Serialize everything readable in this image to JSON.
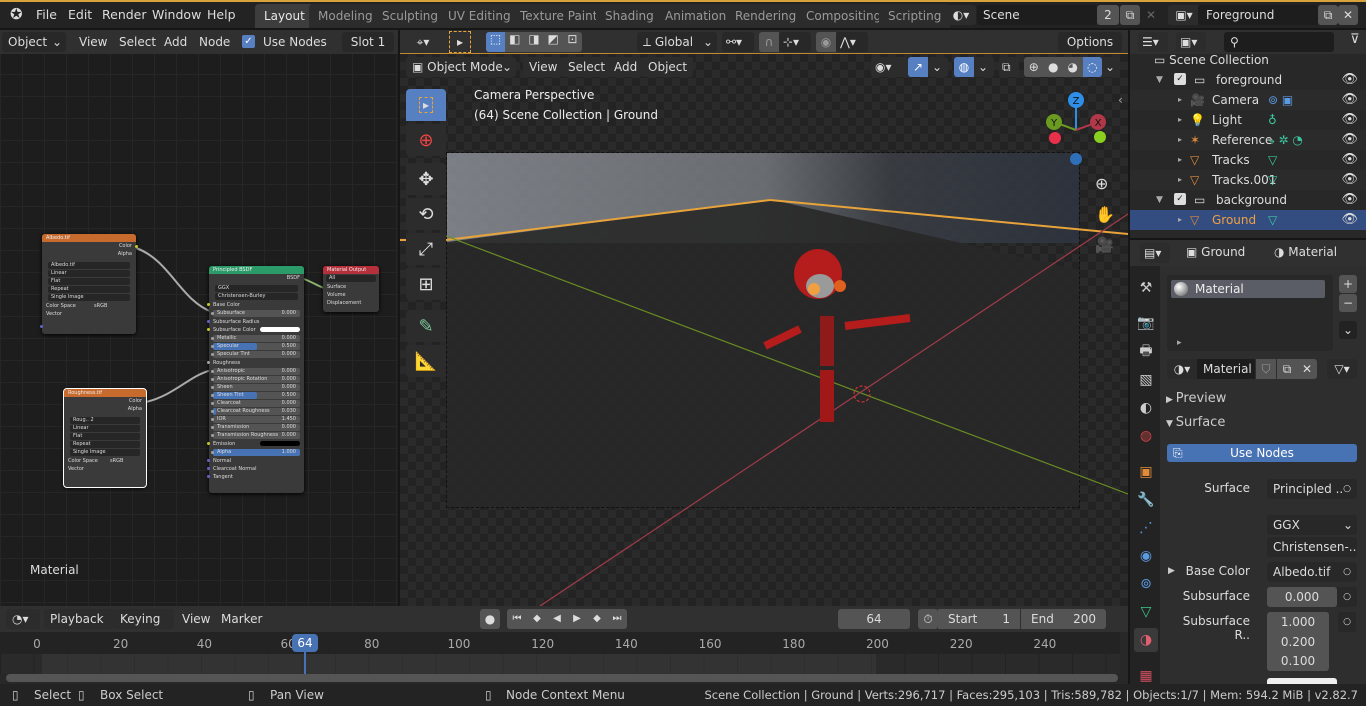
{
  "topbar": {
    "menus": [
      "File",
      "Edit",
      "Render",
      "Window",
      "Help"
    ],
    "workspaces": [
      "Layout",
      "Modeling",
      "Sculpting",
      "UV Editing",
      "Texture Paint",
      "Shading",
      "Animation",
      "Rendering",
      "Compositing",
      "Scripting"
    ],
    "active_workspace": "Layout",
    "scene": {
      "name": "Scene",
      "users": "2"
    },
    "view_layer": "Foreground"
  },
  "node_editor": {
    "header": {
      "mode": "Object",
      "menus": [
        "View",
        "Select",
        "Add",
        "Node"
      ],
      "use_nodes_label": "Use Nodes",
      "use_nodes_checked": true,
      "slot": "Slot 1"
    },
    "label": "Material",
    "albedo_node": {
      "title": "Albedo.tif",
      "outputs": [
        "Color",
        "Alpha"
      ],
      "image": "Albedo.tif",
      "interp": "Linear",
      "proj": "Flat",
      "ext": "Repeat",
      "source": "Single Image",
      "cs_label": "Color Space",
      "cs": "sRGB",
      "input": "Vector"
    },
    "rough_node": {
      "title": "Roughness.tif",
      "outputs": [
        "Color",
        "Alpha"
      ],
      "image": "Roug..",
      "users": "2",
      "interp": "Linear",
      "proj": "Flat",
      "ext": "Repeat",
      "source": "Single Image",
      "cs_label": "Color Space",
      "cs": "sRGB",
      "input": "Vector"
    },
    "bsdf_node": {
      "title": "Principled BSDF",
      "output": "BSDF",
      "dist": "GGX",
      "sss": "Christensen-Burley",
      "rows": [
        {
          "label": "Base Color",
          "type": "socket"
        },
        {
          "label": "Subsurface",
          "value": "0.000"
        },
        {
          "label": "Subsurface Radius",
          "type": "select"
        },
        {
          "label": "Subsurface Color",
          "type": "color"
        },
        {
          "label": "Metallic",
          "value": "0.000"
        },
        {
          "label": "Specular",
          "value": "0.500",
          "fill": 0.5
        },
        {
          "label": "Specular Tint",
          "value": "0.000"
        },
        {
          "label": "Roughness",
          "type": "socket"
        },
        {
          "label": "Anisotropic",
          "value": "0.000"
        },
        {
          "label": "Anisotropic Rotation",
          "value": "0.000"
        },
        {
          "label": "Sheen",
          "value": "0.000"
        },
        {
          "label": "Sheen Tint",
          "value": "0.500",
          "fill": 0.5
        },
        {
          "label": "Clearcoat",
          "value": "0.000"
        },
        {
          "label": "Clearcoat Roughness",
          "value": "0.030",
          "fill": 0.03
        },
        {
          "label": "IOR",
          "value": "1.450"
        },
        {
          "label": "Transmission",
          "value": "0.000"
        },
        {
          "label": "Transmission Roughness",
          "value": "0.000"
        },
        {
          "label": "Emission",
          "type": "black"
        },
        {
          "label": "Alpha",
          "value": "1.000",
          "fill": 1.0
        },
        {
          "label": "Normal",
          "type": "socket"
        },
        {
          "label": "Clearcoat Normal",
          "type": "socket"
        },
        {
          "label": "Tangent",
          "type": "socket"
        }
      ]
    },
    "output_node": {
      "title": "Material Output",
      "target": "All",
      "inputs": [
        "Surface",
        "Volume",
        "Displacement"
      ]
    }
  },
  "viewport": {
    "toolbar": {
      "orientation": "Global",
      "options": "Options"
    },
    "header": {
      "mode": "Object Mode",
      "menus": [
        "View",
        "Select",
        "Add",
        "Object"
      ]
    },
    "overlay_title": "Camera Perspective",
    "overlay_sub": "(64) Scene Collection | Ground",
    "gizmo_axes": [
      "Z",
      "Y",
      "X"
    ]
  },
  "outliner": {
    "root": "Scene Collection",
    "items": [
      {
        "name": "foreground",
        "kind": "collection",
        "depth": 1
      },
      {
        "name": "Camera",
        "kind": "camera",
        "depth": 2
      },
      {
        "name": "Light",
        "kind": "light",
        "depth": 2
      },
      {
        "name": "Reference",
        "kind": "armature",
        "depth": 2
      },
      {
        "name": "Tracks",
        "kind": "mesh",
        "depth": 2
      },
      {
        "name": "Tracks.001",
        "kind": "mesh",
        "depth": 2
      },
      {
        "name": "background",
        "kind": "collection",
        "depth": 1
      },
      {
        "name": "Ground",
        "kind": "mesh",
        "depth": 2,
        "selected": true
      }
    ]
  },
  "properties": {
    "breadcrumb": [
      "Ground",
      "Material"
    ],
    "slots": [
      "Material"
    ],
    "material_name": "Material",
    "panels": {
      "preview": "Preview",
      "surface": "Surface"
    },
    "use_nodes": "Use Nodes",
    "surface": {
      "label": "Surface",
      "value": "Principled .."
    },
    "distribution": "GGX",
    "subsurface_method": "Christensen-..",
    "base_color": {
      "label": "Base Color",
      "value": "Albedo.tif"
    },
    "subsurface": {
      "label": "Subsurface",
      "value": "0.000"
    },
    "subsurface_radius": {
      "label": "Subsurface R..",
      "values": [
        "1.000",
        "0.200",
        "0.100"
      ]
    }
  },
  "timeline": {
    "menus": [
      "Playback",
      "Keying",
      "View",
      "Marker"
    ],
    "current_frame": "64",
    "start_label": "Start",
    "start": "1",
    "end_label": "End",
    "end": "200",
    "ticks": [
      "0",
      "20",
      "40",
      "60",
      "80",
      "100",
      "120",
      "140",
      "160",
      "180",
      "200",
      "220",
      "240"
    ]
  },
  "statusbar": {
    "hints": [
      "Select",
      "Box Select",
      "Pan View",
      "Node Context Menu"
    ],
    "info": "Scene Collection | Ground | Verts:296,717 | Faces:295,103 | Tris:589,782 | Objects:1/7 | Mem: 594.2 MiB | v2.82.7"
  }
}
